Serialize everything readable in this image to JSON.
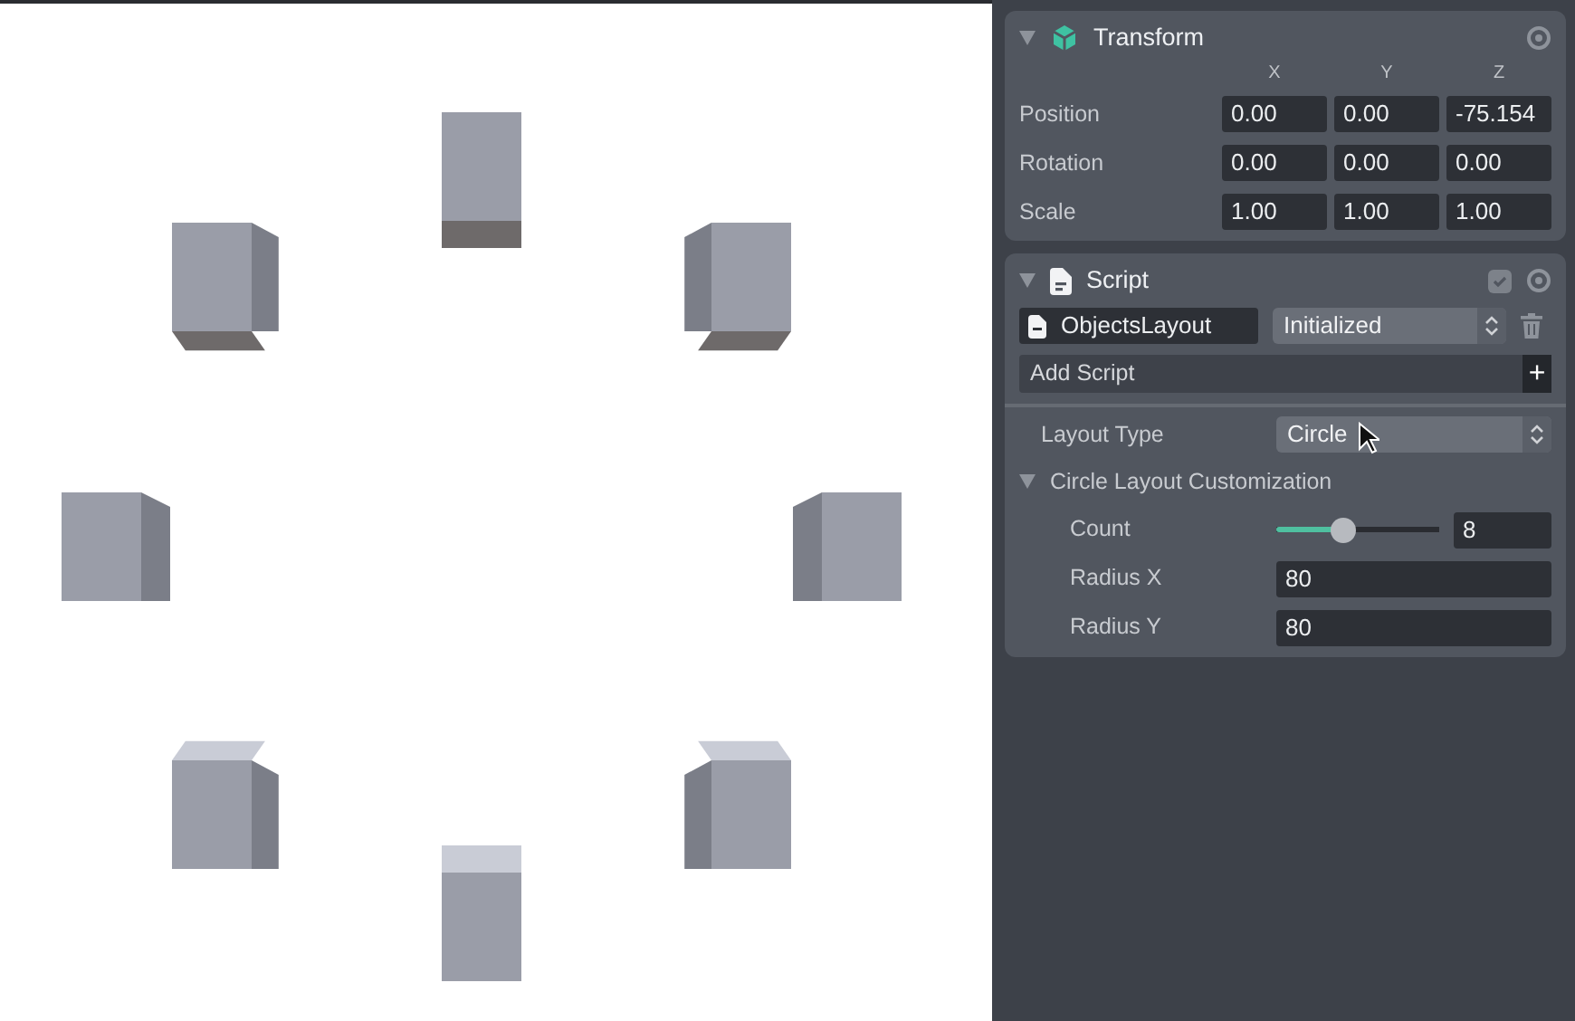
{
  "transform": {
    "title": "Transform",
    "expanded": true,
    "axes": [
      "X",
      "Y",
      "Z"
    ],
    "rows": [
      {
        "label": "Position",
        "values": [
          "0.00",
          "0.00",
          "-75.154"
        ]
      },
      {
        "label": "Rotation",
        "values": [
          "0.00",
          "0.00",
          "0.00"
        ]
      },
      {
        "label": "Scale",
        "values": [
          "1.00",
          "1.00",
          "1.00"
        ]
      }
    ]
  },
  "script": {
    "title": "Script",
    "expanded": true,
    "name": "ObjectsLayout",
    "status": "Initialized",
    "add_label": "Add Script",
    "add_symbol": "+",
    "properties": [
      {
        "kind": "select",
        "label": "Layout Type",
        "value": "Circle"
      },
      {
        "kind": "section",
        "label": "Circle Layout Customization",
        "expanded": true,
        "children": [
          {
            "kind": "slider",
            "label": "Count",
            "level": 0.41,
            "value": "8"
          },
          {
            "kind": "number",
            "label": "Radius X",
            "value": "80"
          },
          {
            "kind": "number",
            "label": "Radius Y",
            "value": "80"
          }
        ]
      }
    ]
  }
}
